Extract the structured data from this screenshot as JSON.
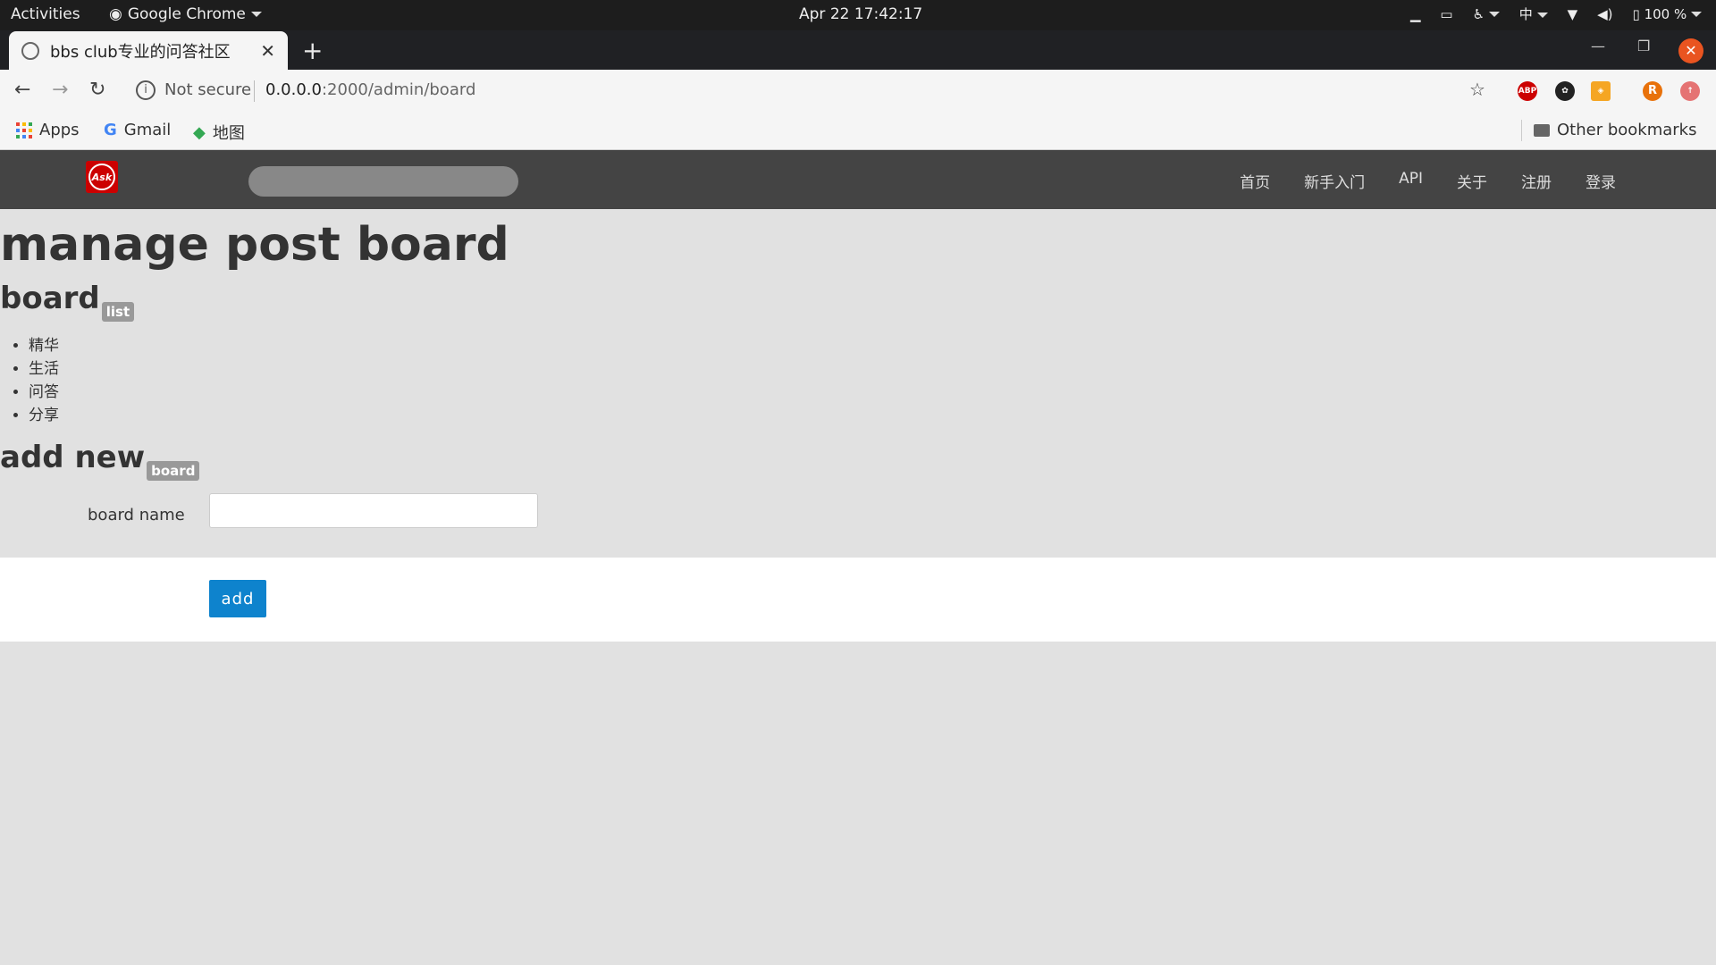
{
  "os_bar": {
    "activities": "Activities",
    "app_name": "Google Chrome",
    "clock": "Apr 22  17:42:17",
    "input_method": "中",
    "battery": "100 %"
  },
  "browser": {
    "tab_title": "bbs club专业的问答社区",
    "url_security": "Not secure",
    "url_host": "0.0.0.0",
    "url_rest": ":2000/admin/board",
    "bookmarks": {
      "apps": "Apps",
      "gmail": "Gmail",
      "maps": "地图",
      "other": "Other bookmarks"
    }
  },
  "site": {
    "logo_text": "Ask",
    "search_placeholder": "",
    "nav": [
      "首页",
      "新手入门",
      "API",
      "关于",
      "注册",
      "登录"
    ]
  },
  "page": {
    "title": "manage post board",
    "board_section": {
      "heading": "board",
      "badge": "list"
    },
    "boards": [
      "精华",
      "生活",
      "问答",
      "分享"
    ],
    "add_section": {
      "heading": "add new",
      "badge": "board"
    },
    "form": {
      "label": "board name",
      "value": "",
      "submit": "add"
    }
  },
  "colors": {
    "nav_bg": "#444444",
    "page_bg": "#e1e1e1",
    "button": "#0e83cd",
    "badge": "#999999"
  }
}
